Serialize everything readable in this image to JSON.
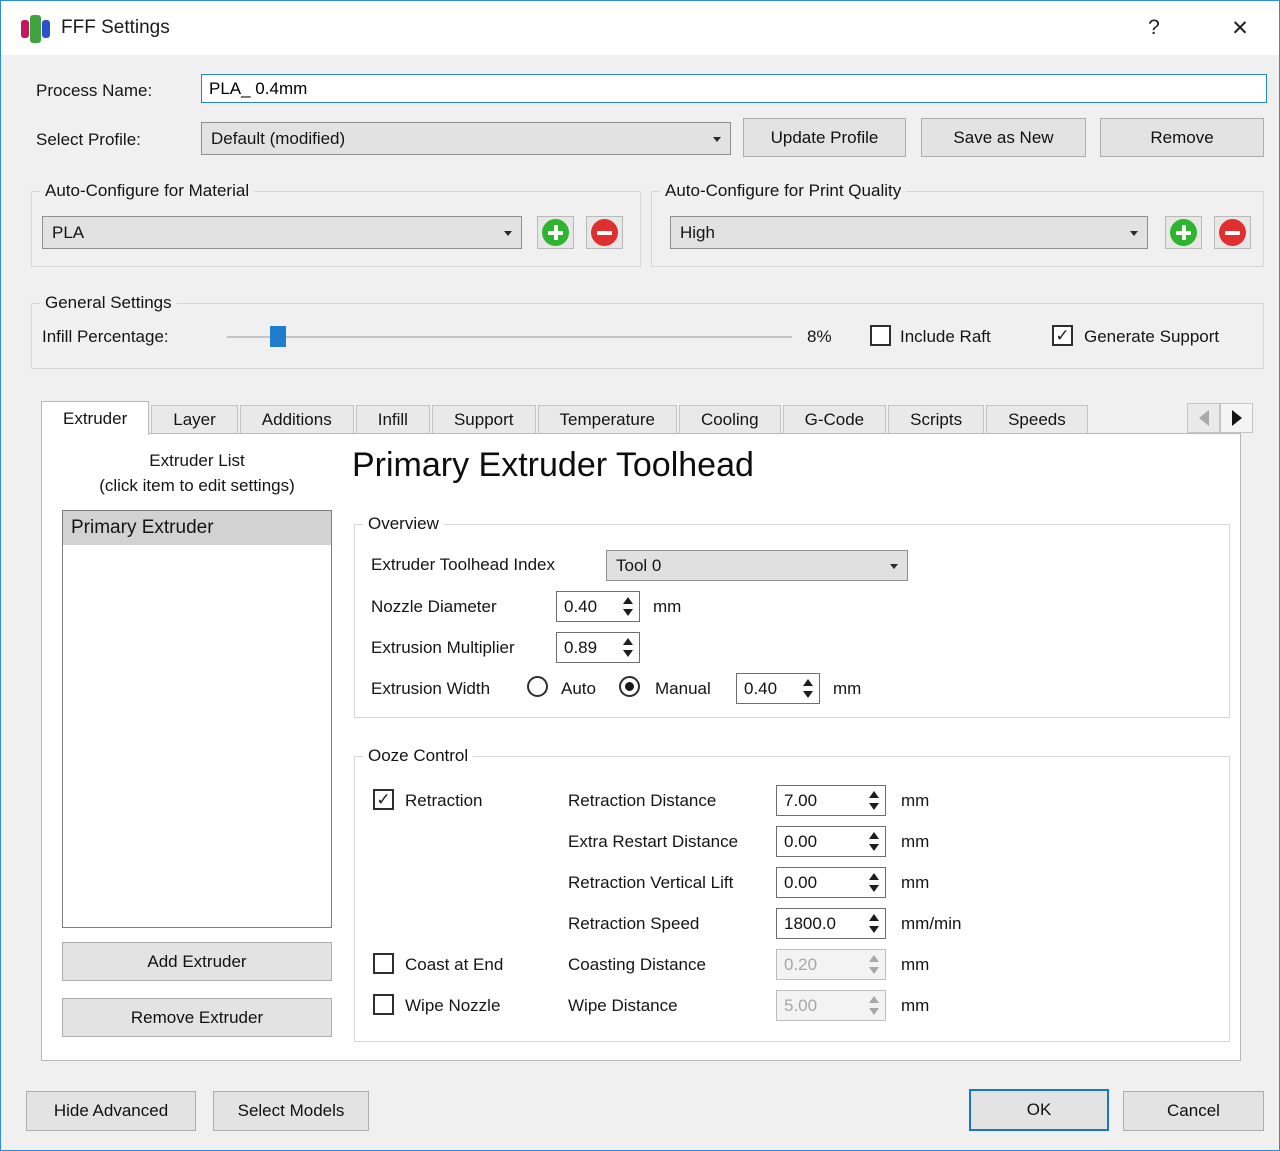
{
  "window": {
    "title": "FFF Settings",
    "help": "?",
    "close": "✕"
  },
  "process": {
    "label": "Process Name:",
    "value": "PLA_ 0.4mm"
  },
  "profile": {
    "label": "Select Profile:",
    "value": "Default (modified)",
    "update": "Update Profile",
    "save_as_new": "Save as New",
    "remove": "Remove"
  },
  "material": {
    "title": "Auto-Configure for Material",
    "value": "PLA"
  },
  "quality": {
    "title": "Auto-Configure for Print Quality",
    "value": "High"
  },
  "general": {
    "title": "General Settings",
    "infill_label": "Infill Percentage:",
    "infill_percent": 8,
    "infill_percent_label": "8%",
    "include_raft_label": "Include Raft",
    "include_raft_checked": false,
    "generate_support_label": "Generate Support",
    "generate_support_checked": true
  },
  "tabs": {
    "labels": [
      "Extruder",
      "Layer",
      "Additions",
      "Infill",
      "Support",
      "Temperature",
      "Cooling",
      "G-Code",
      "Scripts",
      "Speeds"
    ],
    "active": "Extruder"
  },
  "extruder_tab": {
    "list_heading_line1": "Extruder List",
    "list_heading_line2": "(click item to edit settings)",
    "list_items": [
      "Primary Extruder"
    ],
    "selected_item": "Primary Extruder",
    "add_button": "Add Extruder",
    "remove_button": "Remove Extruder",
    "page_title": "Primary Extruder Toolhead",
    "overview": {
      "title": "Overview",
      "toolhead_index": {
        "label": "Extruder Toolhead Index",
        "value": "Tool 0"
      },
      "nozzle_diameter": {
        "label": "Nozzle Diameter",
        "value": "0.40",
        "unit": "mm"
      },
      "extrusion_multiplier": {
        "label": "Extrusion Multiplier",
        "value": "0.89"
      },
      "extrusion_width": {
        "label": "Extrusion Width",
        "auto_label": "Auto",
        "manual_label": "Manual",
        "selected": "Manual",
        "value": "0.40",
        "unit": "mm"
      }
    },
    "ooze_control": {
      "title": "Ooze Control",
      "retraction": {
        "label": "Retraction",
        "checked": true
      },
      "coast_at_end": {
        "label": "Coast at End",
        "checked": false
      },
      "wipe_nozzle": {
        "label": "Wipe Nozzle",
        "checked": false
      },
      "retraction_distance": {
        "label": "Retraction Distance",
        "value": "7.00",
        "unit": "mm",
        "disabled": false
      },
      "extra_restart_distance": {
        "label": "Extra Restart Distance",
        "value": "0.00",
        "unit": "mm",
        "disabled": false
      },
      "retraction_vertical_lift": {
        "label": "Retraction Vertical Lift",
        "value": "0.00",
        "unit": "mm",
        "disabled": false
      },
      "retraction_speed": {
        "label": "Retraction Speed",
        "value": "1800.0",
        "unit": "mm/min",
        "disabled": false
      },
      "coasting_distance": {
        "label": "Coasting Distance",
        "value": "0.20",
        "unit": "mm",
        "disabled": true
      },
      "wipe_distance": {
        "label": "Wipe Distance",
        "value": "5.00",
        "unit": "mm",
        "disabled": true
      }
    }
  },
  "footer": {
    "hide_advanced": "Hide Advanced",
    "select_models": "Select Models",
    "ok": "OK",
    "cancel": "Cancel"
  },
  "colors": {
    "accent_blue": "#1e7ecd",
    "add_green": "#2eb42e",
    "remove_red": "#e02f2f",
    "window_border": "#2f8be0"
  }
}
